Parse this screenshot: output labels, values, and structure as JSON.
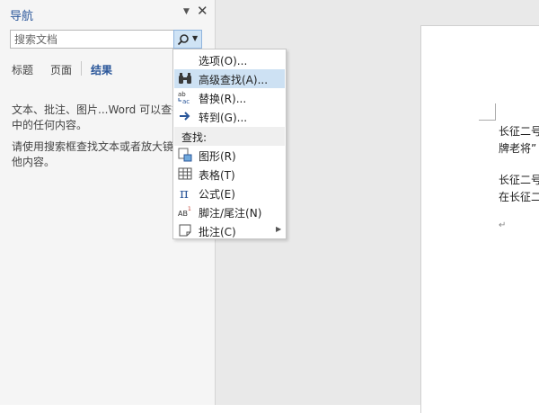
{
  "nav": {
    "title": "导航",
    "search": {
      "placeholder": "搜索文档"
    },
    "tabs": [
      {
        "label": "标题"
      },
      {
        "label": "页面"
      },
      {
        "label": "结果"
      }
    ],
    "info1": [
      "文本、批注、图片...Word 可以查找您的",
      "中的任何内容。"
    ],
    "info2": [
      "请使用搜索框查找文本或者放大镜查找",
      "他内容。"
    ]
  },
  "menu": {
    "items": [
      {
        "label": "选项(O)...",
        "icon": "none"
      },
      {
        "label": "高级查找(A)...",
        "icon": "binoculars-icon"
      },
      {
        "label": "替换(R)...",
        "icon": "replace-icon"
      },
      {
        "label": "转到(G)...",
        "icon": "arrow-right-icon"
      }
    ],
    "find_header": "查找:",
    "find_items": [
      {
        "label": "图形(R)",
        "icon": "shape-icon"
      },
      {
        "label": "表格(T)",
        "icon": "table-icon"
      },
      {
        "label": "公式(E)",
        "icon": "pi-icon"
      },
      {
        "label": "脚注/尾注(N)",
        "icon": "footnote-icon"
      },
      {
        "label": "批注(C)",
        "icon": "comment-icon"
      }
    ]
  },
  "document": {
    "lines": [
      "长征二号",
      "牌老将”",
      "长征二号",
      "在长征二号"
    ]
  },
  "colors": {
    "accent": "#2b579a",
    "highlight": "#cde1f3"
  }
}
